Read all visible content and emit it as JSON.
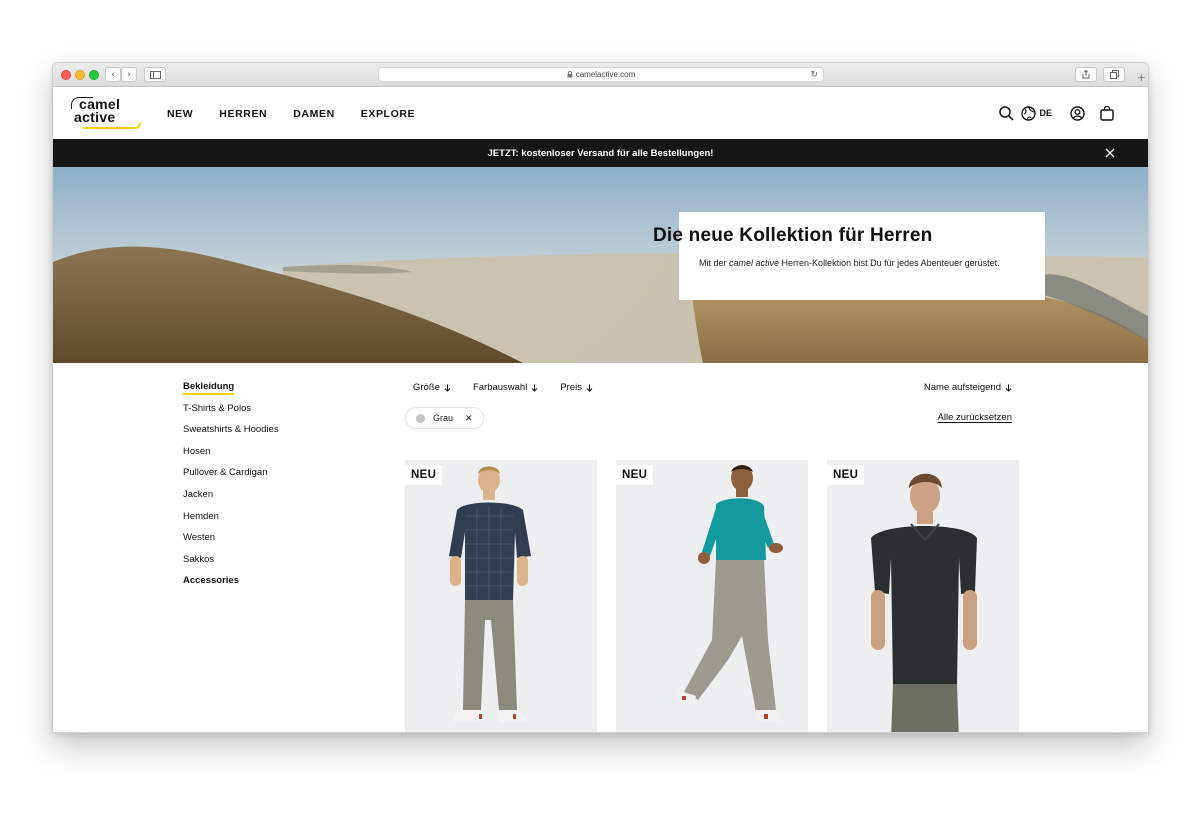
{
  "browser": {
    "url": "camelactive.com"
  },
  "header": {
    "logo_line1": "camel",
    "logo_line2": "active",
    "nav": [
      {
        "label": "NEW"
      },
      {
        "label": "HERREN"
      },
      {
        "label": "DAMEN"
      },
      {
        "label": "EXPLORE"
      }
    ],
    "language": "DE"
  },
  "banner": {
    "text": "JETZT: kostenloser Versand für alle Bestellungen!"
  },
  "hero": {
    "title": "Die neue Kollektion für Herren",
    "subtitle_pre": "Mit der ",
    "subtitle_brand": "camel active",
    "subtitle_post": " Herren-Kollektion bist Du für jedes Abenteuer gerüstet."
  },
  "sidebar": {
    "items": [
      {
        "label": "Bekleidung"
      },
      {
        "label": "T-Shirts & Polos"
      },
      {
        "label": "Sweatshirts & Hoodies"
      },
      {
        "label": "Hosen"
      },
      {
        "label": "Pullover & Cardigan"
      },
      {
        "label": "Jacken"
      },
      {
        "label": "Hemden"
      },
      {
        "label": "Westen"
      },
      {
        "label": "Sakkos"
      },
      {
        "label": "Accessories"
      }
    ]
  },
  "filters": {
    "items": [
      {
        "label": "Größe"
      },
      {
        "label": "Farbauswahl"
      },
      {
        "label": "Preis"
      }
    ],
    "sort": "Name aufsteigend",
    "chip": "Grau",
    "reset": "Alle zurücksetzen"
  },
  "products": [
    {
      "badge": "NEU"
    },
    {
      "badge": "NEU"
    },
    {
      "badge": "NEU"
    }
  ],
  "colors": {
    "accent": "#f2d200",
    "banner_bg": "#161616"
  }
}
